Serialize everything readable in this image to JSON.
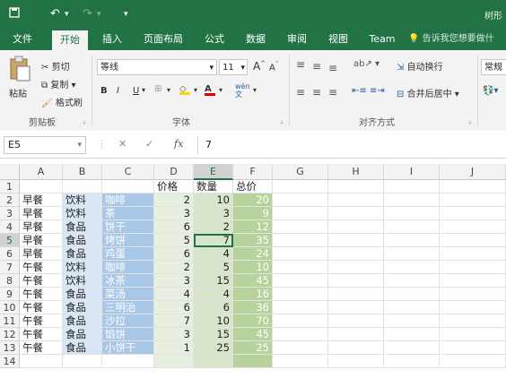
{
  "titlebar": {
    "save_icon": "save-icon",
    "undo_icon": "undo-icon",
    "redo_icon": "redo-icon",
    "customize_icon": "customize-toolbar-icon",
    "right_text": "树形",
    "accent": "#217346"
  },
  "tabs": [
    "文件",
    "开始",
    "插入",
    "页面布局",
    "公式",
    "数据",
    "审阅",
    "视图",
    "Team"
  ],
  "active_tab": "开始",
  "tellme": "告诉我您想要做什",
  "ribbon": {
    "clipboard": {
      "paste": "粘贴",
      "cut": "剪切",
      "copy": "复制",
      "format_painter": "格式刷",
      "label": "剪贴板"
    },
    "font": {
      "font_name": "等线",
      "font_size": "11",
      "bold": "B",
      "italic": "I",
      "underline": "U",
      "font_color_glyph": "A",
      "phonetic": "wén",
      "label": "字体",
      "increase": "A",
      "decrease": "A"
    },
    "alignment": {
      "wrap_text": "自动换行",
      "merge_center": "合并后居中",
      "label": "对齐方式"
    },
    "number": {
      "format": "常规"
    }
  },
  "formula_bar": {
    "name_box": "E5",
    "cancel": "✕",
    "enter": "✓",
    "fx": "fx",
    "value": "7"
  },
  "columns": [
    "A",
    "B",
    "C",
    "D",
    "E",
    "F",
    "G",
    "H",
    "I",
    "J"
  ],
  "selected_column": "E",
  "rows": [
    "1",
    "2",
    "3",
    "4",
    "5",
    "6",
    "7",
    "8",
    "9",
    "10",
    "11",
    "12",
    "13",
    "14"
  ],
  "selected_row": "5",
  "header_row": {
    "D": "价格",
    "E": "数量",
    "F": "总价"
  },
  "data_rows": [
    {
      "A": "早餐",
      "B": "饮料",
      "C": "咖啡",
      "D": "2",
      "E": "10",
      "F": "20"
    },
    {
      "A": "早餐",
      "B": "饮料",
      "C": "茶",
      "D": "3",
      "E": "3",
      "F": "9"
    },
    {
      "A": "早餐",
      "B": "食品",
      "C": "饼干",
      "D": "6",
      "E": "2",
      "F": "12"
    },
    {
      "A": "早餐",
      "B": "食品",
      "C": "烤饼",
      "D": "5",
      "E": "7",
      "F": "35"
    },
    {
      "A": "早餐",
      "B": "食品",
      "C": "鸡蛋",
      "D": "6",
      "E": "4",
      "F": "24"
    },
    {
      "A": "午餐",
      "B": "饮料",
      "C": "咖啡",
      "D": "2",
      "E": "5",
      "F": "10"
    },
    {
      "A": "午餐",
      "B": "饮料",
      "C": "冰茶",
      "D": "3",
      "E": "15",
      "F": "45"
    },
    {
      "A": "午餐",
      "B": "食品",
      "C": "菜汤",
      "D": "4",
      "E": "4",
      "F": "16"
    },
    {
      "A": "午餐",
      "B": "食品",
      "C": "三明治",
      "D": "6",
      "E": "6",
      "F": "36"
    },
    {
      "A": "午餐",
      "B": "食品",
      "C": "沙拉",
      "D": "7",
      "E": "10",
      "F": "70"
    },
    {
      "A": "午餐",
      "B": "食品",
      "C": "馅饼",
      "D": "3",
      "E": "15",
      "F": "45"
    },
    {
      "A": "午餐",
      "B": "食品",
      "C": "小饼干",
      "D": "1",
      "E": "25",
      "F": "25"
    }
  ]
}
